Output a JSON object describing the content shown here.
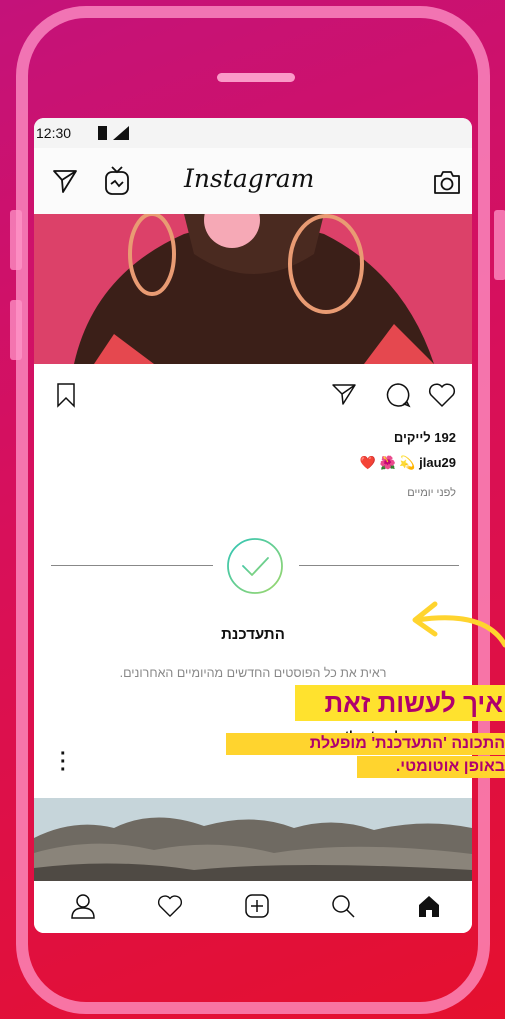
{
  "status": {
    "time": "12:30"
  },
  "app": {
    "title": "Instagram"
  },
  "post": {
    "likes": "192 לייקים",
    "username": "jlau29",
    "caption_emojis": "❤️ 🌺 💫",
    "time_ago": "לפני יומיים"
  },
  "caught_up": {
    "title": "התעדכנת",
    "subtitle": "ראית את כל הפוסטים החדשים מהיומיים האחרונים."
  },
  "next_post": {
    "username": "amethyst_grl"
  },
  "callout": {
    "line1": "איך לעשות זאת",
    "line2": "התכונה 'התעדכנת' מופעלת",
    "line3": "באופן אוטומטי."
  },
  "colors": {
    "accent_yellow": "#ffe22e",
    "callout_text": "#b0006e",
    "check_gradient_start": "#2ec4b6",
    "check_gradient_end": "#9fd86b"
  }
}
